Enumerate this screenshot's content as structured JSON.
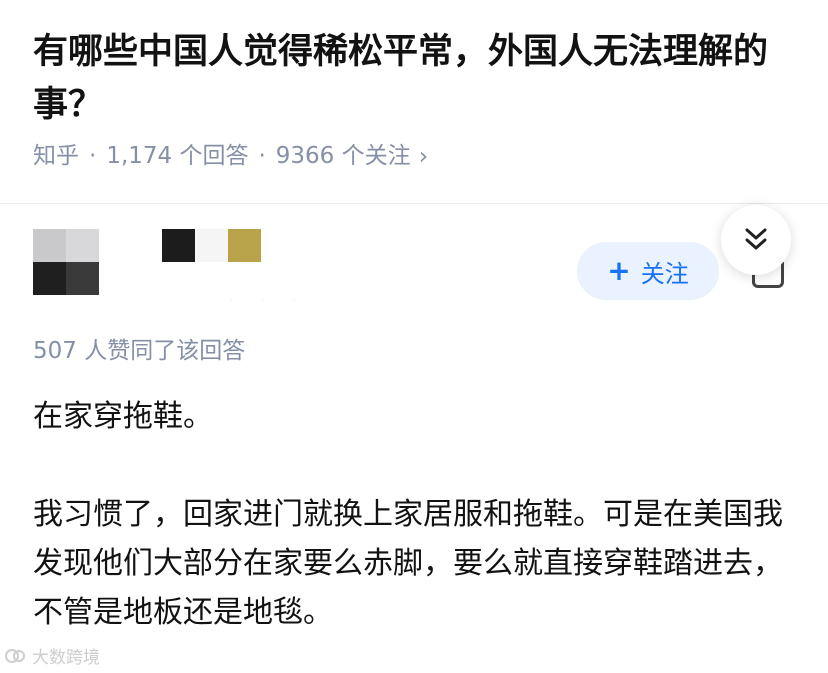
{
  "question": {
    "title": "有哪些中国人觉得稀松平常，外国人无法理解的事？",
    "source": "知乎",
    "answer_count": "1,174 个回答",
    "follower_count": "9366 个关注"
  },
  "answer": {
    "follow_label": "关注",
    "vote_text": "507 人赞同了该回答",
    "paragraphs": [
      "在家穿拖鞋。",
      "我习惯了，回家进门就换上家居服和拖鞋。可是在美国我发现他们大部分在家要么赤脚，要么就直接穿鞋踏进去，不管是地板还是地毯。"
    ]
  },
  "watermark": {
    "text": "大数跨境"
  },
  "colors": {
    "accent": "#1772f6",
    "follow_bg": "#eaf2ff",
    "meta_text": "#8590a6"
  },
  "icons": {
    "follow": "plus-icon",
    "collapse": "double-chevron-down-icon",
    "more": "more-icon",
    "meta": "chevron-right-icon"
  }
}
